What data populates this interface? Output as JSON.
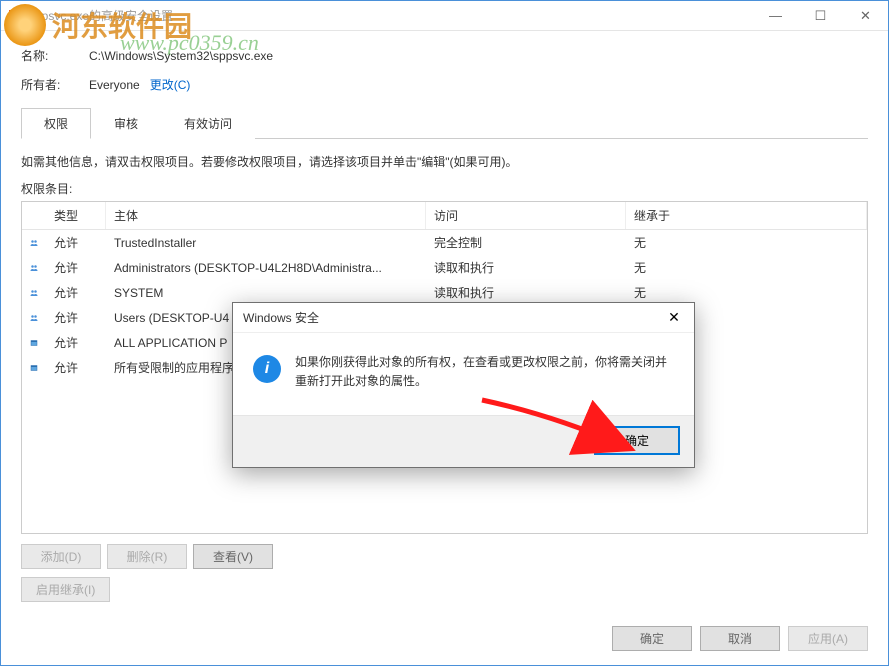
{
  "titlebar": {
    "title": "sppsvc.exe的高级安全设置"
  },
  "watermark": {
    "logo_text": "河东软件园",
    "url": "www.pc0359.cn"
  },
  "fields": {
    "name_label": "名称:",
    "name_value": "C:\\Windows\\System32\\sppsvc.exe",
    "owner_label": "所有者:",
    "owner_value": "Everyone",
    "change_link": "更改(C)"
  },
  "tabs": {
    "permissions": "权限",
    "auditing": "审核",
    "effective": "有效访问"
  },
  "help_text": "如需其他信息，请双击权限项目。若要修改权限项目，请选择该项目并单击\"编辑\"(如果可用)。",
  "perm_label": "权限条目:",
  "columns": {
    "type": "类型",
    "principal": "主体",
    "access": "访问",
    "inherit": "继承于"
  },
  "rows": [
    {
      "icon": "group",
      "type": "允许",
      "principal": "TrustedInstaller",
      "access": "完全控制",
      "inherit": "无"
    },
    {
      "icon": "group",
      "type": "允许",
      "principal": "Administrators (DESKTOP-U4L2H8D\\Administra...",
      "access": "读取和执行",
      "inherit": "无"
    },
    {
      "icon": "group",
      "type": "允许",
      "principal": "SYSTEM",
      "access": "读取和执行",
      "inherit": "无"
    },
    {
      "icon": "group",
      "type": "允许",
      "principal": "Users (DESKTOP-U4",
      "access": "",
      "inherit": ""
    },
    {
      "icon": "pkg",
      "type": "允许",
      "principal": "ALL APPLICATION P",
      "access": "",
      "inherit": ""
    },
    {
      "icon": "pkg",
      "type": "允许",
      "principal": "所有受限制的应用程序",
      "access": "",
      "inherit": ""
    }
  ],
  "buttons": {
    "add": "添加(D)",
    "remove": "删除(R)",
    "view": "查看(V)",
    "enable_inherit": "启用继承(I)",
    "ok": "确定",
    "cancel": "取消",
    "apply": "应用(A)"
  },
  "modal": {
    "title": "Windows 安全",
    "text": "如果你刚获得此对象的所有权，在查看或更改权限之前，你将需关闭并重新打开此对象的属性。",
    "ok": "确定"
  }
}
